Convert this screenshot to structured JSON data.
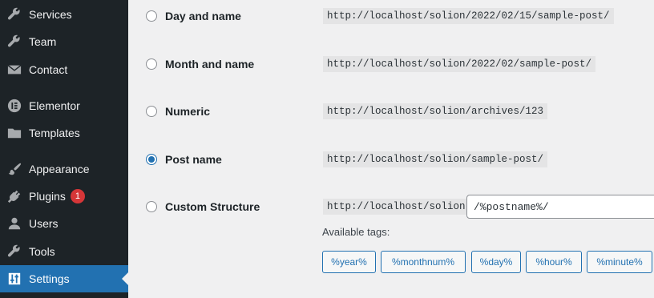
{
  "sidebar": {
    "items": [
      {
        "label": "Services",
        "icon": "wrench-icon"
      },
      {
        "label": "Team",
        "icon": "wrench-icon"
      },
      {
        "label": "Contact",
        "icon": "envelope-icon"
      },
      {
        "label": "Elementor",
        "icon": "elementor-icon"
      },
      {
        "label": "Templates",
        "icon": "folder-icon"
      },
      {
        "label": "Appearance",
        "icon": "paintbrush-icon"
      },
      {
        "label": "Plugins",
        "icon": "plug-icon",
        "badge": "1"
      },
      {
        "label": "Users",
        "icon": "user-icon"
      },
      {
        "label": "Tools",
        "icon": "wrench-icon"
      },
      {
        "label": "Settings",
        "icon": "settings-sliders-icon",
        "active": true
      }
    ]
  },
  "permalinks": {
    "options": [
      {
        "label": "Day and name",
        "example": "http://localhost/solion/2022/02/15/sample-post/",
        "checked": false
      },
      {
        "label": "Month and name",
        "example": "http://localhost/solion/2022/02/sample-post/",
        "checked": false
      },
      {
        "label": "Numeric",
        "example": "http://localhost/solion/archives/123",
        "checked": false
      },
      {
        "label": "Post name",
        "example": "http://localhost/solion/sample-post/",
        "checked": true
      },
      {
        "label": "Custom Structure",
        "example": "http://localhost/solion",
        "checked": false
      }
    ],
    "custom_value": "/%postname%/",
    "available_tags_label": "Available tags:",
    "tags": [
      "%year%",
      "%monthnum%",
      "%day%",
      "%hour%",
      "%minute%"
    ]
  },
  "colors": {
    "sidebar_bg": "#1d2327",
    "accent": "#2271b1",
    "badge": "#d63638"
  }
}
